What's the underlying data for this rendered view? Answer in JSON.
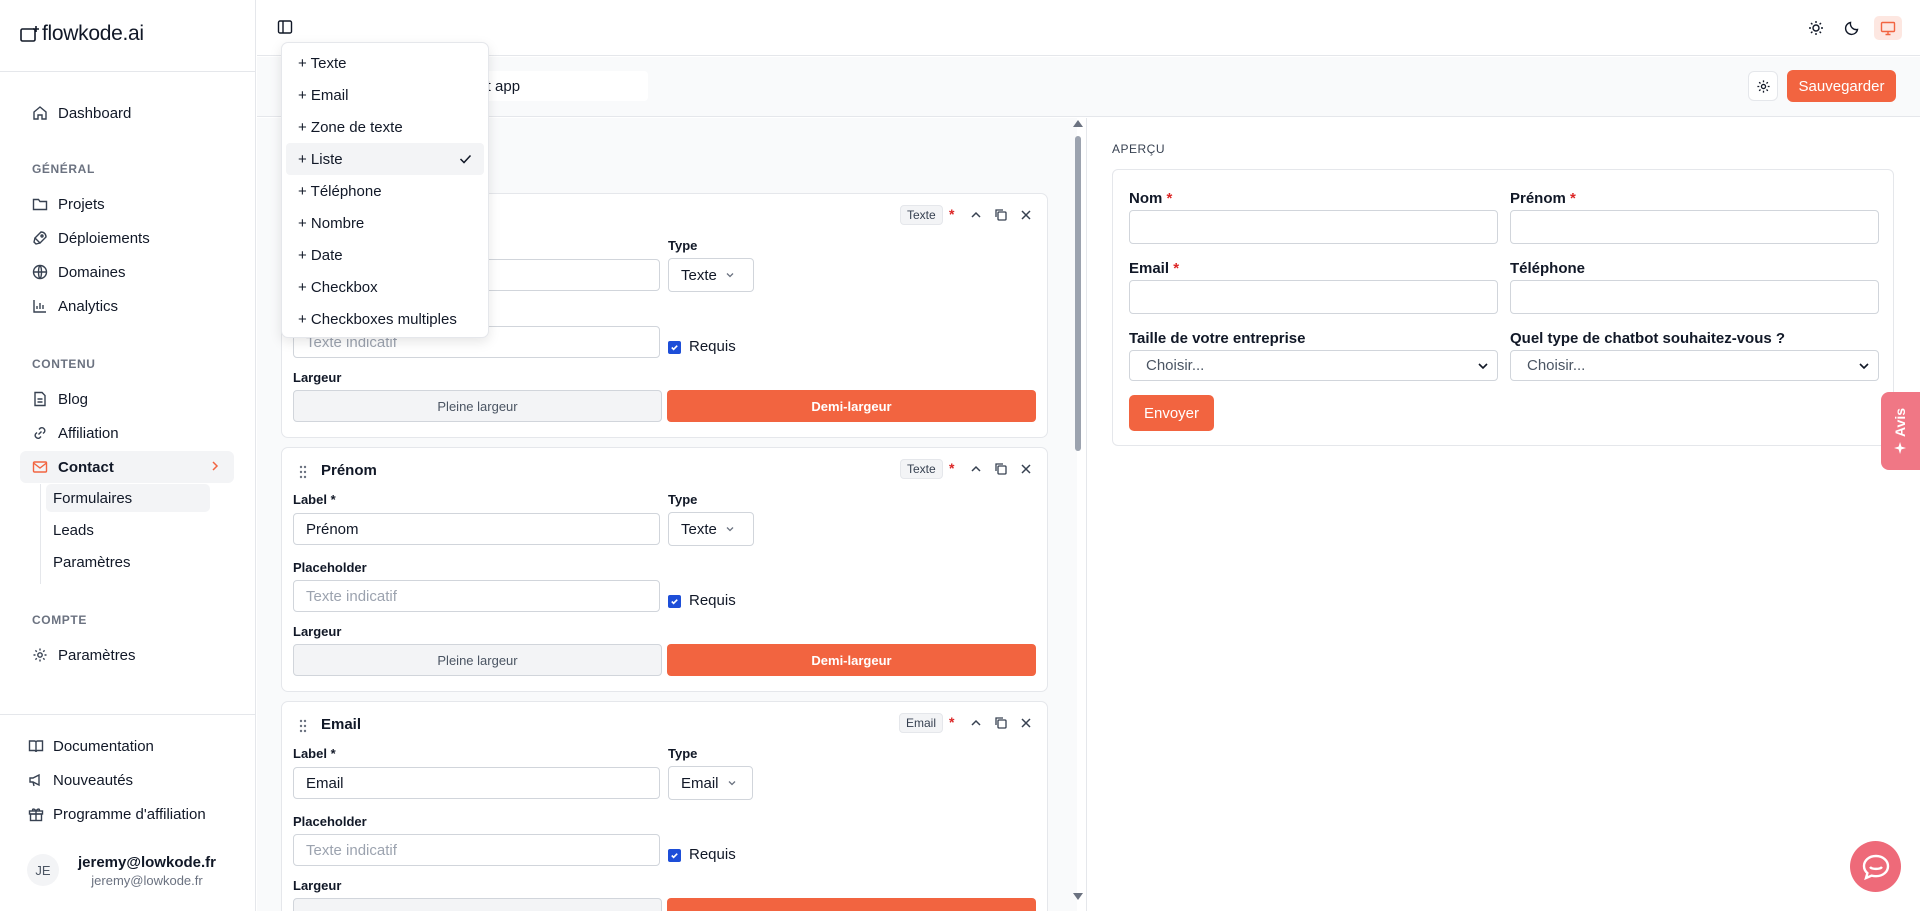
{
  "brand": {
    "name": "flowkode.ai"
  },
  "sidebar": {
    "dashboard": "Dashboard",
    "sections": {
      "general": "GÉNÉRAL",
      "content": "CONTENU",
      "account": "COMPTE"
    },
    "general_items": [
      "Projets",
      "Déploiements",
      "Domaines",
      "Analytics"
    ],
    "content_items": [
      "Blog",
      "Affiliation",
      "Contact"
    ],
    "contact_sub": [
      "Formulaires",
      "Leads",
      "Paramètres"
    ],
    "account_items": [
      "Paramètres"
    ],
    "bottom": [
      "Documentation",
      "Nouveautés",
      "Programme d'affiliation"
    ],
    "user": {
      "initials": "JE",
      "name": "jeremy@lowkode.fr",
      "email": "jeremy@lowkode.fr"
    }
  },
  "toolbar": {
    "form_name": "oot app",
    "save_label": "Sauvegarder"
  },
  "field_menu": {
    "items": [
      "+ Texte",
      "+ Email",
      "+ Zone de texte",
      "+ Liste",
      "+ Téléphone",
      "+ Nombre",
      "+ Date",
      "+ Checkbox",
      "+ Checkboxes multiples"
    ],
    "selected_index": 3
  },
  "editor": {
    "labels": {
      "label": "Label *",
      "type": "Type",
      "placeholder": "Placeholder",
      "width": "Largeur",
      "required": "Requis",
      "full": "Pleine largeur",
      "half": "Demi-largeur"
    },
    "fields": [
      {
        "title": "Nom",
        "badge": "Texte",
        "value": "",
        "type": "Texte",
        "placeholder": "Texte indicatif"
      },
      {
        "title": "Prénom",
        "badge": "Texte",
        "value": "Prénom",
        "type": "Texte",
        "placeholder": "Texte indicatif"
      },
      {
        "title": "Email",
        "badge": "Email",
        "value": "Email",
        "type": "Email",
        "placeholder": "Texte indicatif"
      }
    ]
  },
  "preview": {
    "heading": "APERÇU",
    "labels": {
      "nom": "Nom",
      "prenom": "Prénom",
      "email": "Email",
      "telephone": "Téléphone",
      "taille": "Taille de votre entreprise",
      "chatbot": "Quel type de chatbot souhaitez-vous ?"
    },
    "required_mark": "*",
    "choose": "Choisir...",
    "submit": "Envoyer"
  },
  "feedback_tab": "Avis",
  "colors": {
    "accent": "#f26440",
    "required": "#dc2626",
    "feedback": "#f07785"
  }
}
